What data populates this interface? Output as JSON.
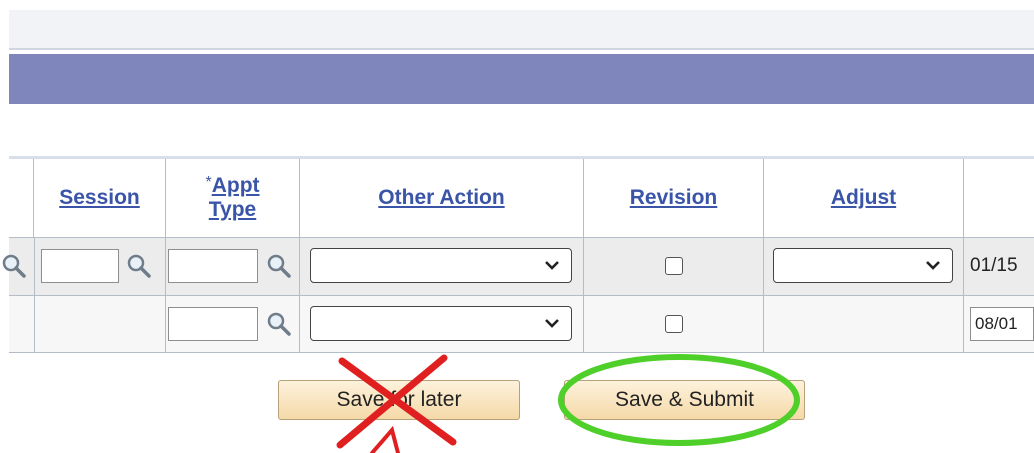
{
  "columns": {
    "session": "Session",
    "appt_required_mark": "*",
    "appt_line1": "Appt",
    "appt_line2": "Type",
    "other_action": "Other Action",
    "revision": "Revision",
    "adjust": "Adjust"
  },
  "rows": [
    {
      "date": "01/15"
    },
    {
      "date": "08/01"
    }
  ],
  "buttons": {
    "save_later": "Save for later",
    "save_submit": "Save & Submit"
  },
  "annotations": {
    "cross_color": "#e02020",
    "circle_color": "#4fcf2a",
    "arrow_color": "#e02020"
  },
  "colors": {
    "header_bar": "#7f86bb",
    "link": "#3a55a8",
    "button_top": "#fdf2dc",
    "button_bottom": "#f5d9a8"
  }
}
